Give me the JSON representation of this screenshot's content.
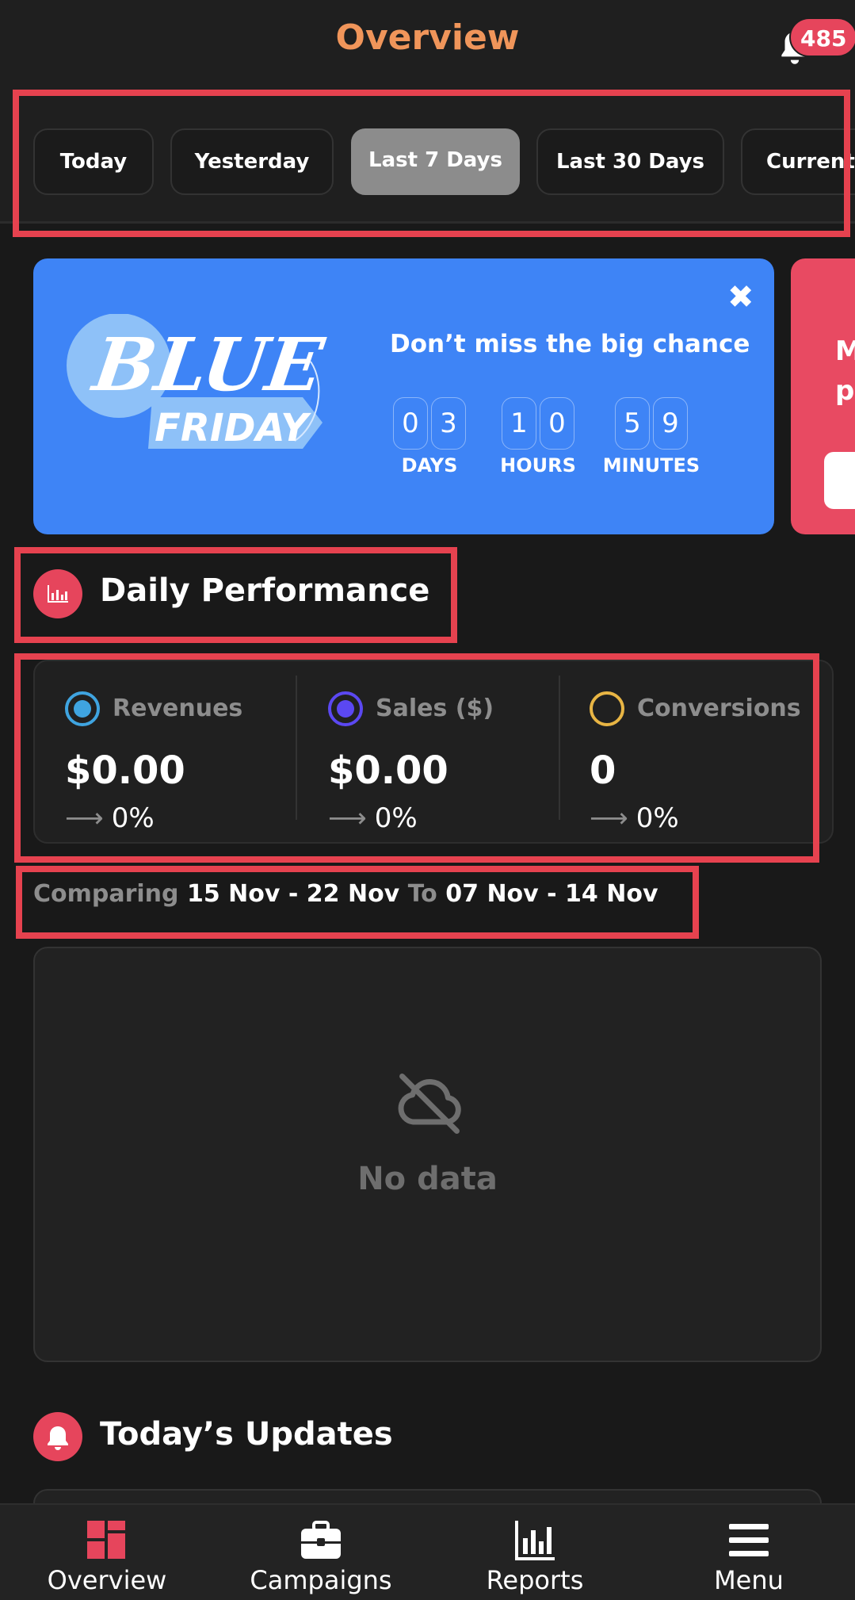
{
  "header": {
    "title": "Overview",
    "notification_count": "485"
  },
  "date_filters": [
    {
      "label": "Today",
      "active": false
    },
    {
      "label": "Yesterday",
      "active": false
    },
    {
      "label": "Last 7 Days",
      "active": true
    },
    {
      "label": "Last 30 Days",
      "active": false
    },
    {
      "label": "Current Month",
      "active": false
    }
  ],
  "promo": {
    "logo_text": "BLUE FRIDAY",
    "heading": "Don’t miss the big chance",
    "countdown": {
      "days": [
        "0",
        "3"
      ],
      "hours": [
        "1",
        "0"
      ],
      "minutes": [
        "5",
        "9"
      ],
      "days_label": "DAYS",
      "hours_label": "HOURS",
      "minutes_label": "MINUTES"
    }
  },
  "promo2": {
    "text_line1": "M",
    "text_line2": "p"
  },
  "daily_performance": {
    "title": "Daily Performance",
    "metrics": [
      {
        "label": "Revenues",
        "value": "$0.00",
        "change": "0%",
        "color": "#3fa4e0",
        "selected": true
      },
      {
        "label": "Sales ($)",
        "value": "$0.00",
        "change": "0%",
        "color": "#5b48f2",
        "selected": true
      },
      {
        "label": "Conversions",
        "value": "0",
        "change": "0%",
        "color": "#e8b544",
        "selected": false
      }
    ]
  },
  "comparing": {
    "prefix": "Comparing",
    "current_range": "15 Nov - 22 Nov",
    "to": "To",
    "previous_range": "07 Nov - 14 Nov"
  },
  "chart": {
    "empty_text": "No data"
  },
  "updates": {
    "title": "Today’s Updates"
  },
  "bottom_nav": [
    {
      "label": "Overview",
      "icon": "dashboard-icon",
      "active": true
    },
    {
      "label": "Campaigns",
      "icon": "briefcase-icon",
      "active": false
    },
    {
      "label": "Reports",
      "icon": "bar-chart-icon",
      "active": false
    },
    {
      "label": "Menu",
      "icon": "hamburger-icon",
      "active": false
    }
  ],
  "colors": {
    "accent": "#e6455c",
    "title_orange": "#f0955a",
    "promo_blue": "#3e84f6",
    "highlight_red": "#e6424f"
  }
}
